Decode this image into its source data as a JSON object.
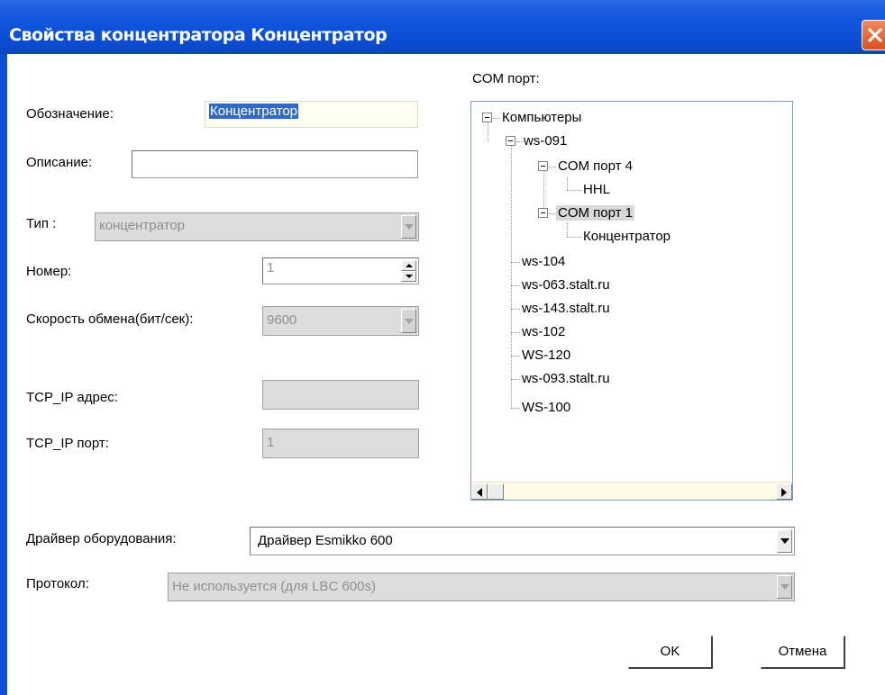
{
  "window": {
    "title": "Свойства концентратора Концентратор",
    "close_icon": "close-icon"
  },
  "form": {
    "designation_label": "Обозначение:",
    "designation_value": "Концентратор",
    "description_label": "Описание:",
    "description_value": "",
    "type_label": "Тип :",
    "type_value": "концентратор",
    "number_label": "Номер:",
    "number_value": "1",
    "speed_label": "Скорость обмена(бит/сек):",
    "speed_value": "9600",
    "tcpip_address_label": "TCP_IP адрес:",
    "tcpip_address_value": "",
    "tcpip_port_label": "TCP_IP порт:",
    "tcpip_port_value": "1",
    "driver_label": "Драйвер оборудования:",
    "driver_value": "Драйвер Esmikko 600",
    "protocol_label": "Протокол:",
    "protocol_value": "Не используется (для LBC 600s)"
  },
  "com_port": {
    "label": "COM порт:",
    "tree": {
      "root": "Компьютеры",
      "computer": "ws-091",
      "port4": "COM порт 4",
      "port4_child": "HHL",
      "port1": "COM порт 1",
      "port1_child": "Концентратор",
      "others": [
        "ws-104",
        "ws-063.stalt.ru",
        "ws-143.stalt.ru",
        "ws-102",
        "WS-120",
        "ws-093.stalt.ru",
        "WS-100"
      ]
    }
  },
  "buttons": {
    "ok": "OK",
    "cancel": "Отмена"
  },
  "colors": {
    "titlebar": "#0a4fd6",
    "selection": "#316ac5",
    "close_button": "#d9501f"
  }
}
